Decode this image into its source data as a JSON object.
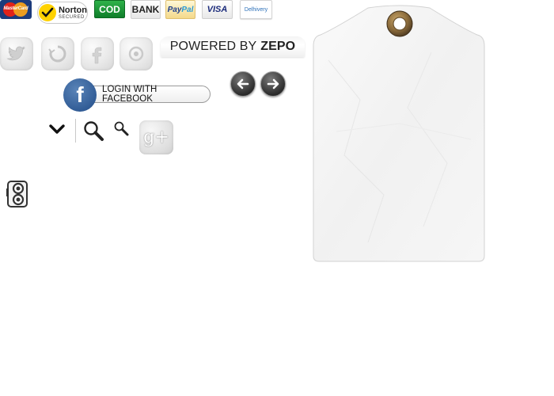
{
  "payment_badges": {
    "mastercard": "MasterCard",
    "norton_title": "Norton",
    "norton_sub": "SECURED",
    "cod": "COD",
    "bank": "BANK",
    "paypal_a": "Pay",
    "paypal_b": "Pal",
    "visa": "VISA",
    "delhivery": "Delhivery"
  },
  "social_icons": [
    "twitter-icon",
    "refresh-icon",
    "facebook-icon",
    "pinterest-icon"
  ],
  "powered": {
    "prefix": "POWERED BY",
    "brand": "ZEPO"
  },
  "facebook_login": {
    "letter": "f",
    "label": "LOGIN WITH FACEBOOK"
  },
  "google_plus": {
    "label": "g+"
  },
  "colors": {
    "facebook_blue": "#2f5a94",
    "cod_green": "#1a9a3a",
    "zepo_text": "#222222"
  }
}
